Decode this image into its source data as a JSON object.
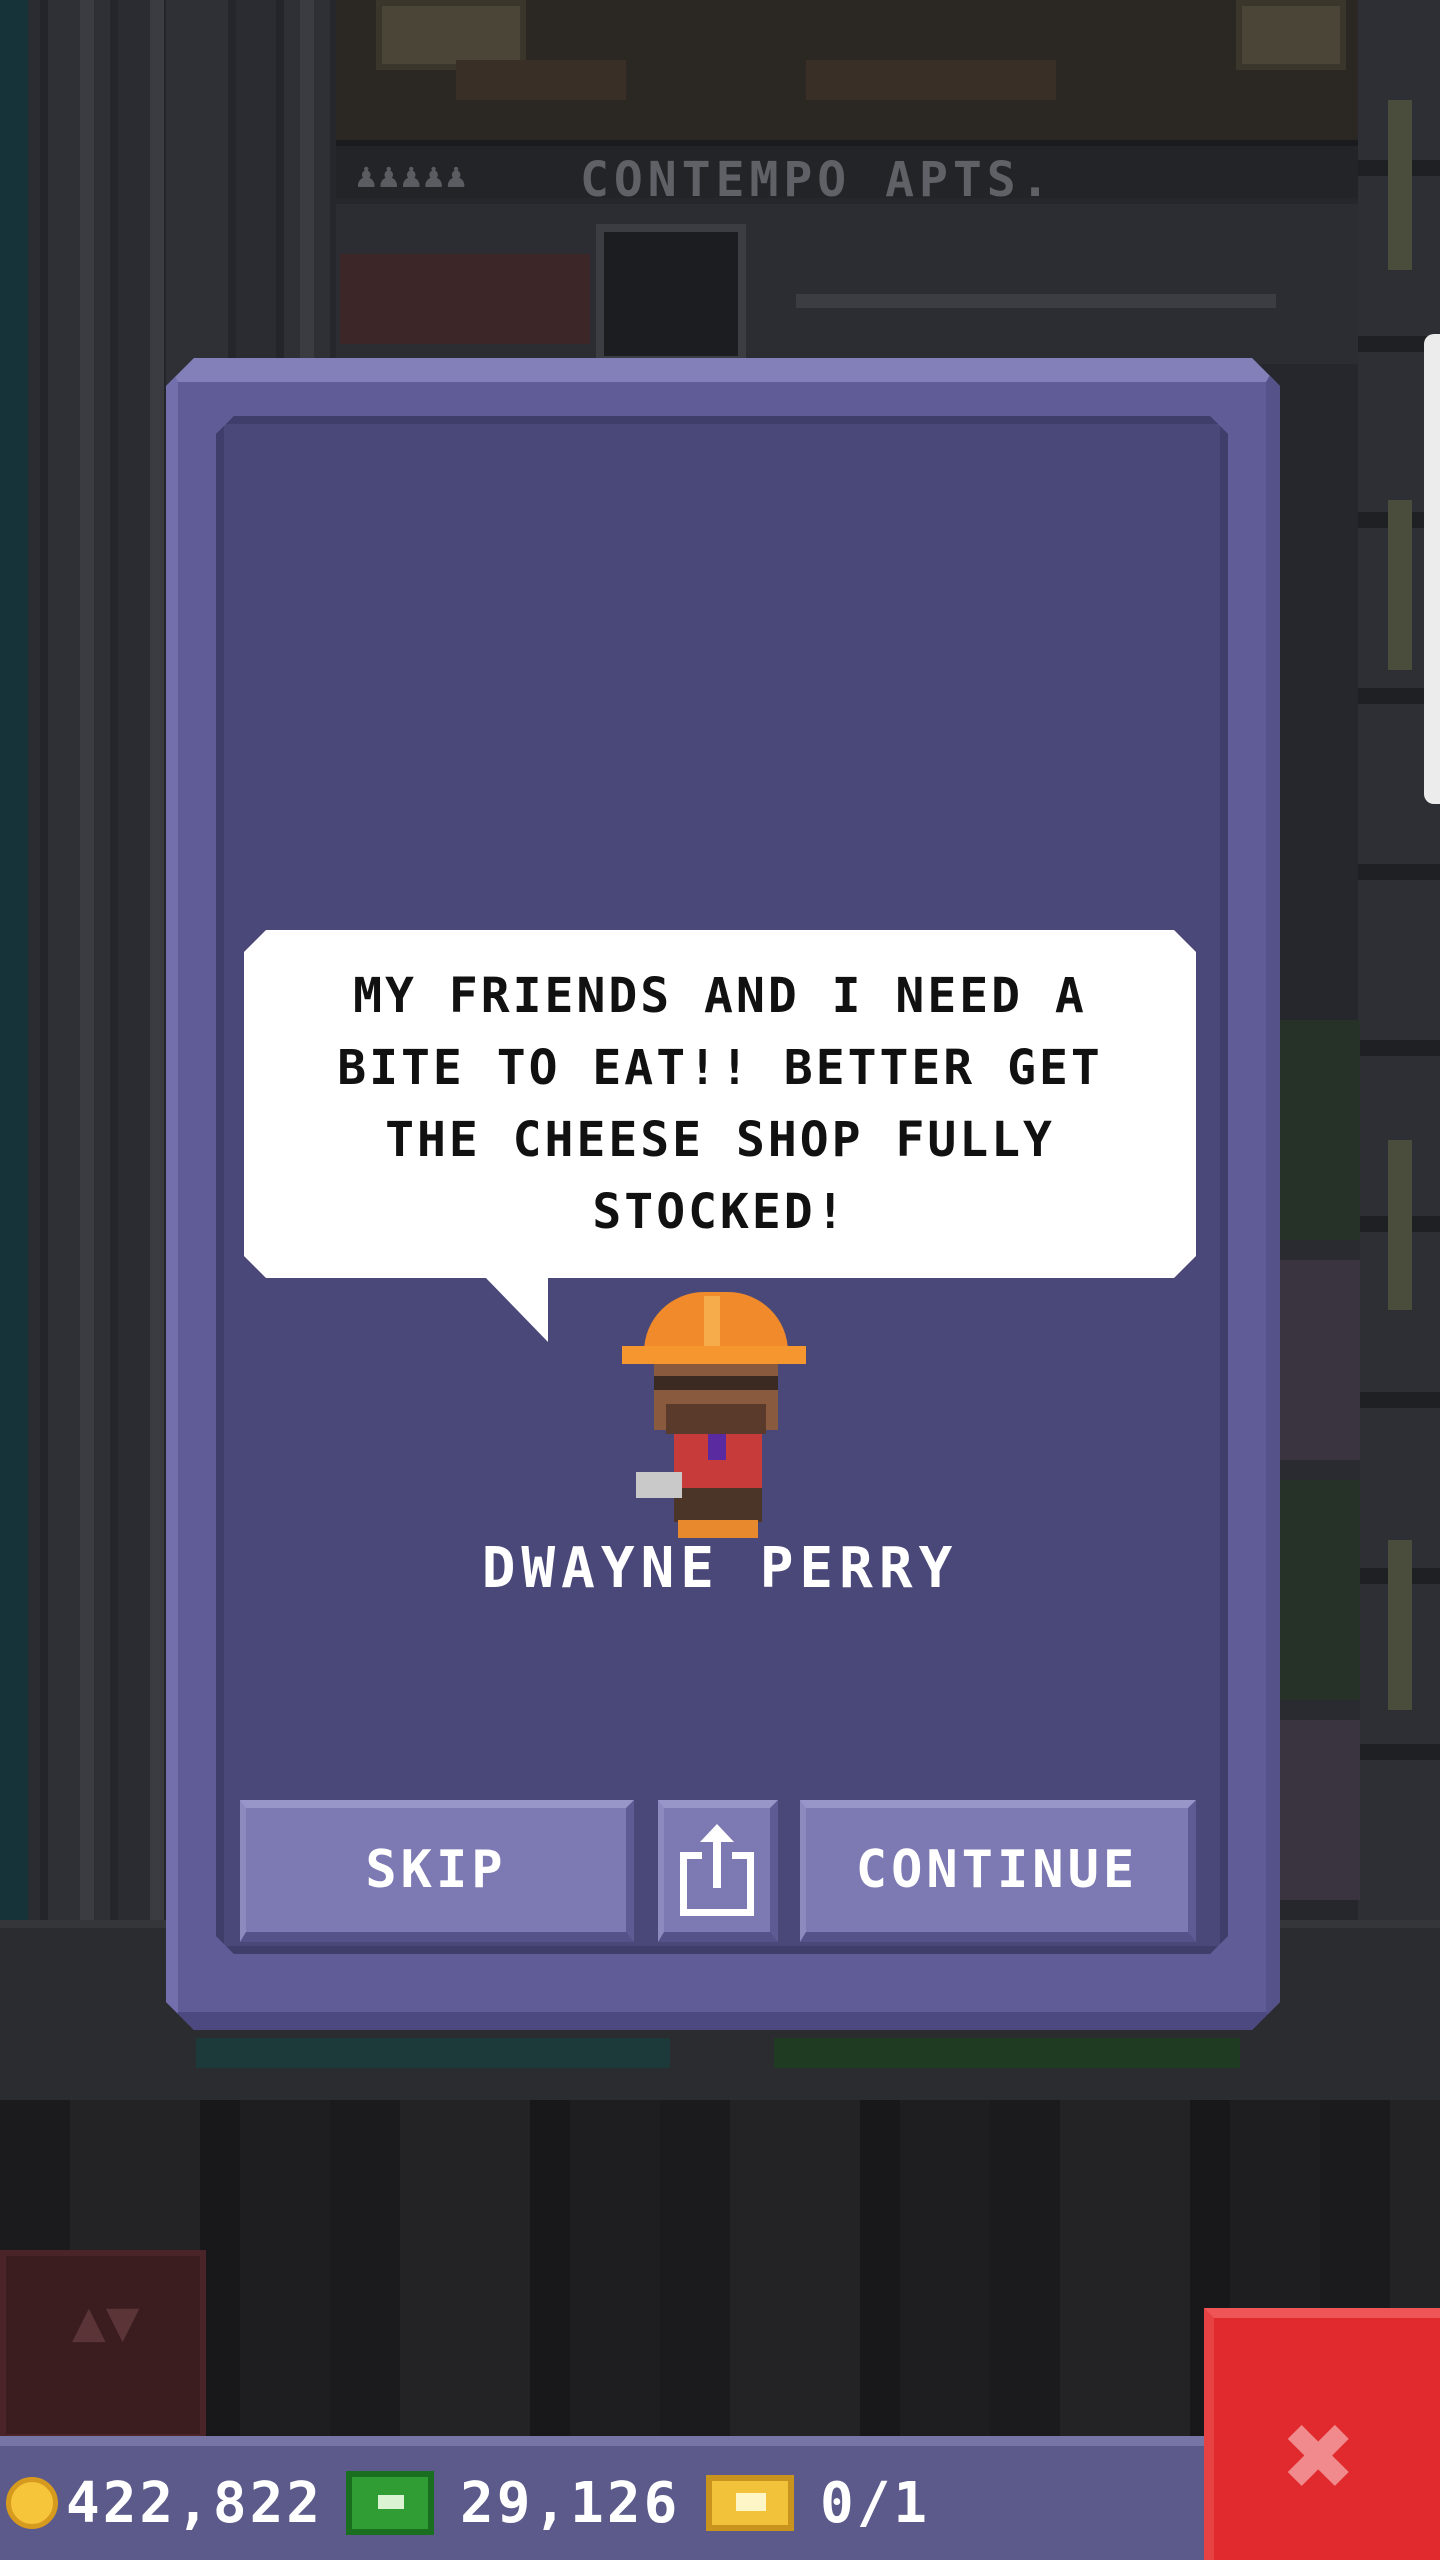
{
  "background": {
    "floor_sign": "CONTEMPO APTS.",
    "floor_sign_people": "♟♟♟♟♟"
  },
  "dialog": {
    "speech": "MY FRIENDS AND I NEED A BITE TO EAT!! BETTER GET THE CHEESE SHOP FULLY STOCKED!",
    "character_name": "DWAYNE PERRY",
    "skip_label": "SKIP",
    "share_icon": "share-icon",
    "continue_label": "CONTINUE"
  },
  "hud": {
    "coins": "422,822",
    "bux": "29,126",
    "tickets": "0/1"
  },
  "controls": {
    "elevator_arrows": "▲▼",
    "close_glyph": "✖"
  },
  "colors": {
    "panel": "#5f5c98",
    "panel_inner": "#4a4878",
    "button": "#7c79b3",
    "close_red": "#e02a2e",
    "coin": "#f6c53a",
    "bux_green": "#2f9d33",
    "ticket_gold": "#f2c23a"
  }
}
